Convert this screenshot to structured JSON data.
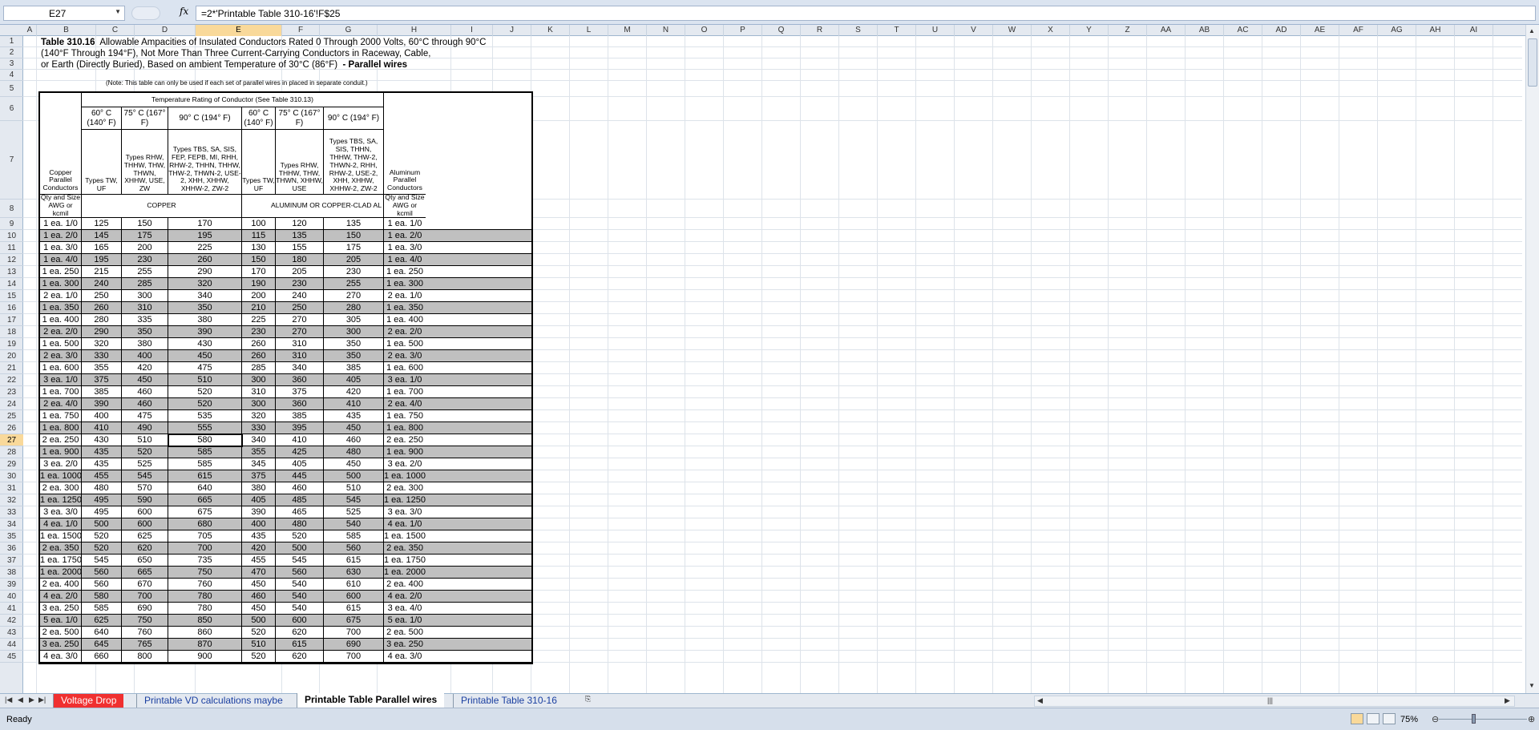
{
  "formula_bar": {
    "name_box": "E27",
    "fx": "fx",
    "formula": "=2*'Printable Table 310-16'!F$25"
  },
  "columns": [
    "A",
    "B",
    "C",
    "D",
    "E",
    "F",
    "G",
    "H",
    "I",
    "J",
    "K",
    "L",
    "M",
    "N",
    "O",
    "P",
    "Q",
    "R",
    "S",
    "T",
    "U",
    "V",
    "W",
    "X",
    "Y",
    "Z",
    "AA",
    "AB",
    "AC",
    "AD",
    "AE",
    "AF",
    "AG",
    "AH",
    "AI"
  ],
  "selected_column": "E",
  "selected_row": "27",
  "title": {
    "bold": "Table 310.16",
    "line1": "Allowable Ampacities of Insulated Conductors Rated 0 Through 2000 Volts, 60°C through 90°C",
    "line2": "(140°F Through 194°F), Not More Than Three Current-Carrying Conductors in Raceway, Cable,",
    "line3": "or Earth (Directly Buried), Based on ambient Temperature of 30°C (86°F)",
    "line3_bold": "- Parallel wires",
    "note": "(Note:  This table can only be used if each set of parallel wires in placed in separate conduit.)"
  },
  "table_header": {
    "temp_rating": "Temperature Rating of Conductor (See Table 310.13)",
    "t60": "60° C (140° F)",
    "t75": "75° C (167° F)",
    "t90": "90° C (194° F)",
    "types_tw": "Types TW, UF",
    "types_rhw": "Types RHW, THHW, THW, THWN, XHHW, USE, ZW",
    "types_tbs": "Types TBS, SA, SIS, FEP, FEPB, MI, RHH, RHW-2, THHN, THHW, THW-2, THWN-2, USE-2, XHH, XHHW, XHHW-2, ZW-2",
    "types_rhw_al": "Types RHW, THHW, THW, THWN, XHHW, USE",
    "types_tbs_al": "Types TBS, SA, SIS, THHN, THHW, THW-2, THWN-2, RHH, RHW-2, USE-2, XHH, XHHW, XHHW-2, ZW-2",
    "copper_parallel": "Copper Parallel Conductors",
    "qty_size_left": "Qty and Size AWG or kcmil",
    "copper": "COPPER",
    "aluminum": "ALUMINUM OR COPPER-CLAD AL",
    "aluminum_parallel": "Aluminum Parallel Conductors",
    "qty_size_right": "Qty and Size AWG or kcmil"
  },
  "rows": [
    [
      "1 ea. 1/0",
      "125",
      "150",
      "170",
      "100",
      "120",
      "135",
      "1 ea. 1/0"
    ],
    [
      "1 ea. 2/0",
      "145",
      "175",
      "195",
      "115",
      "135",
      "150",
      "1 ea. 2/0"
    ],
    [
      "1 ea. 3/0",
      "165",
      "200",
      "225",
      "130",
      "155",
      "175",
      "1 ea. 3/0"
    ],
    [
      "1 ea. 4/0",
      "195",
      "230",
      "260",
      "150",
      "180",
      "205",
      "1 ea. 4/0"
    ],
    [
      "1 ea. 250",
      "215",
      "255",
      "290",
      "170",
      "205",
      "230",
      "1 ea. 250"
    ],
    [
      "1 ea. 300",
      "240",
      "285",
      "320",
      "190",
      "230",
      "255",
      "1 ea. 300"
    ],
    [
      "2 ea. 1/0",
      "250",
      "300",
      "340",
      "200",
      "240",
      "270",
      "2 ea. 1/0"
    ],
    [
      "1 ea. 350",
      "260",
      "310",
      "350",
      "210",
      "250",
      "280",
      "1 ea. 350"
    ],
    [
      "1 ea. 400",
      "280",
      "335",
      "380",
      "225",
      "270",
      "305",
      "1 ea. 400"
    ],
    [
      "2 ea. 2/0",
      "290",
      "350",
      "390",
      "230",
      "270",
      "300",
      "2 ea. 2/0"
    ],
    [
      "1 ea. 500",
      "320",
      "380",
      "430",
      "260",
      "310",
      "350",
      "1 ea. 500"
    ],
    [
      "2 ea. 3/0",
      "330",
      "400",
      "450",
      "260",
      "310",
      "350",
      "2 ea. 3/0"
    ],
    [
      "1 ea. 600",
      "355",
      "420",
      "475",
      "285",
      "340",
      "385",
      "1 ea. 600"
    ],
    [
      "3 ea. 1/0",
      "375",
      "450",
      "510",
      "300",
      "360",
      "405",
      "3 ea. 1/0"
    ],
    [
      "1 ea. 700",
      "385",
      "460",
      "520",
      "310",
      "375",
      "420",
      "1 ea. 700"
    ],
    [
      "2 ea. 4/0",
      "390",
      "460",
      "520",
      "300",
      "360",
      "410",
      "2 ea. 4/0"
    ],
    [
      "1 ea. 750",
      "400",
      "475",
      "535",
      "320",
      "385",
      "435",
      "1 ea. 750"
    ],
    [
      "1 ea. 800",
      "410",
      "490",
      "555",
      "330",
      "395",
      "450",
      "1 ea. 800"
    ],
    [
      "2 ea. 250",
      "430",
      "510",
      "580",
      "340",
      "410",
      "460",
      "2 ea. 250"
    ],
    [
      "1 ea. 900",
      "435",
      "520",
      "585",
      "355",
      "425",
      "480",
      "1 ea. 900"
    ],
    [
      "3 ea. 2/0",
      "435",
      "525",
      "585",
      "345",
      "405",
      "450",
      "3 ea. 2/0"
    ],
    [
      "1 ea. 1000",
      "455",
      "545",
      "615",
      "375",
      "445",
      "500",
      "1 ea. 1000"
    ],
    [
      "2 ea. 300",
      "480",
      "570",
      "640",
      "380",
      "460",
      "510",
      "2 ea. 300"
    ],
    [
      "1 ea. 1250",
      "495",
      "590",
      "665",
      "405",
      "485",
      "545",
      "1 ea. 1250"
    ],
    [
      "3 ea. 3/0",
      "495",
      "600",
      "675",
      "390",
      "465",
      "525",
      "3 ea. 3/0"
    ],
    [
      "4 ea. 1/0",
      "500",
      "600",
      "680",
      "400",
      "480",
      "540",
      "4 ea. 1/0"
    ],
    [
      "1 ea. 1500",
      "520",
      "625",
      "705",
      "435",
      "520",
      "585",
      "1 ea. 1500"
    ],
    [
      "2 ea. 350",
      "520",
      "620",
      "700",
      "420",
      "500",
      "560",
      "2 ea. 350"
    ],
    [
      "1 ea. 1750",
      "545",
      "650",
      "735",
      "455",
      "545",
      "615",
      "1 ea. 1750"
    ],
    [
      "1 ea. 2000",
      "560",
      "665",
      "750",
      "470",
      "560",
      "630",
      "1 ea. 2000"
    ],
    [
      "2 ea. 400",
      "560",
      "670",
      "760",
      "450",
      "540",
      "610",
      "2 ea. 400"
    ],
    [
      "4 ea. 2/0",
      "580",
      "700",
      "780",
      "460",
      "540",
      "600",
      "4 ea. 2/0"
    ],
    [
      "3 ea. 250",
      "585",
      "690",
      "780",
      "450",
      "540",
      "615",
      "3 ea. 4/0"
    ],
    [
      "5 ea. 1/0",
      "625",
      "750",
      "850",
      "500",
      "600",
      "675",
      "5 ea. 1/0"
    ],
    [
      "2 ea. 500",
      "640",
      "760",
      "860",
      "520",
      "620",
      "700",
      "2 ea. 500"
    ],
    [
      "3 ea. 250",
      "645",
      "765",
      "870",
      "510",
      "615",
      "690",
      "3 ea. 250"
    ],
    [
      "4 ea. 3/0",
      "660",
      "800",
      "900",
      "520",
      "620",
      "700",
      "4 ea. 3/0"
    ]
  ],
  "row_numbers": [
    "1",
    "2",
    "3",
    "4",
    "5",
    "6",
    "7",
    "8",
    "9",
    "10",
    "11",
    "12",
    "13",
    "14",
    "15",
    "16",
    "17",
    "18",
    "19",
    "20",
    "21",
    "22",
    "23",
    "24",
    "25",
    "26",
    "27",
    "28",
    "29",
    "30",
    "31",
    "32",
    "33",
    "34",
    "35",
    "36",
    "37",
    "38",
    "39",
    "40",
    "41",
    "42",
    "43",
    "44",
    "45"
  ],
  "tabs": [
    "Voltage Drop",
    "Printable VD calculations maybe",
    "Printable Table Parallel wires",
    "Printable  Table 310-16"
  ],
  "active_tab": "Printable Table Parallel wires",
  "status": {
    "ready": "Ready",
    "zoom": "75%"
  }
}
